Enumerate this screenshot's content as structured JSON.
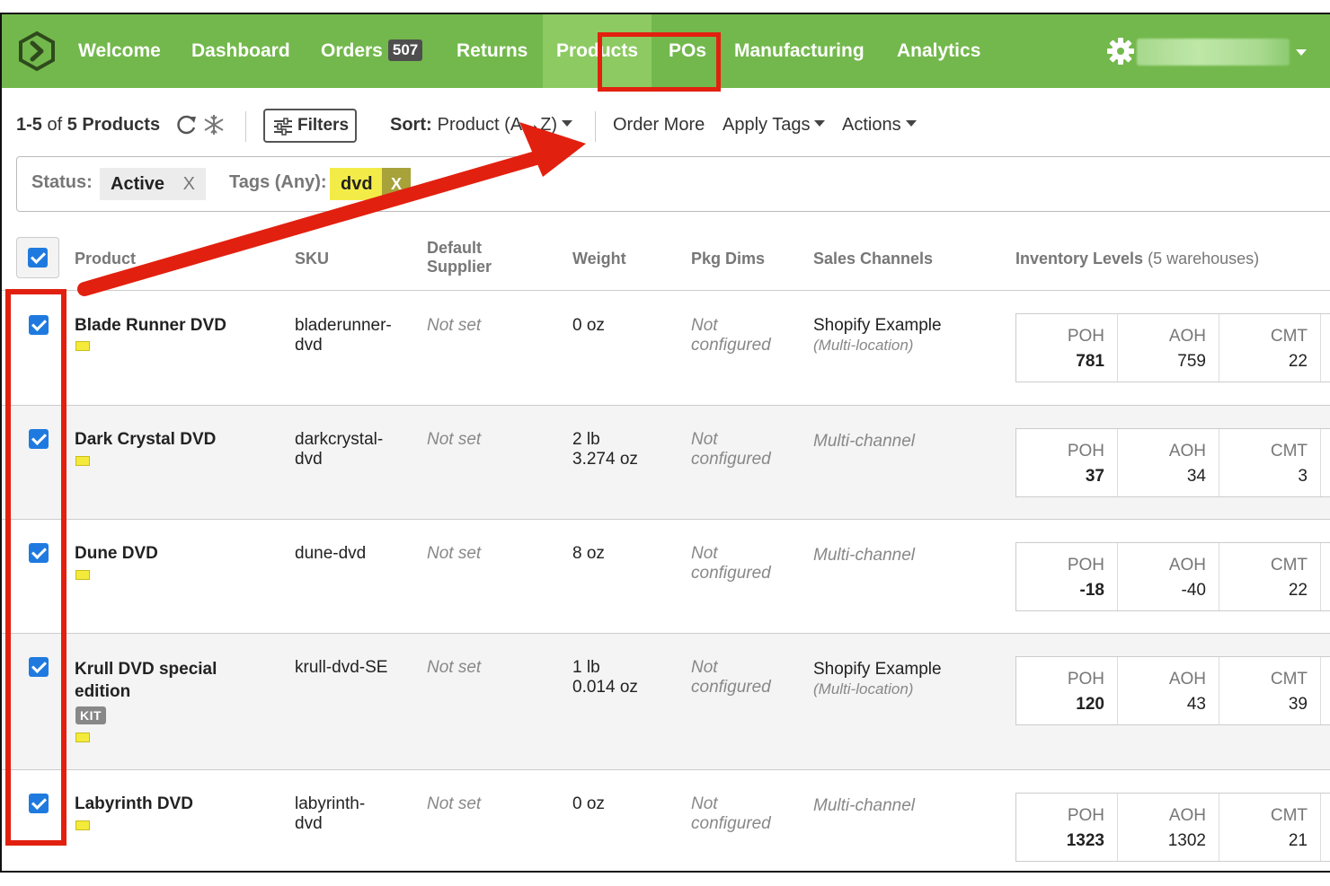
{
  "nav": {
    "items": [
      {
        "label": "Welcome"
      },
      {
        "label": "Dashboard"
      },
      {
        "label": "Orders",
        "badge": "507"
      },
      {
        "label": "Returns"
      },
      {
        "label": "Products",
        "active": true
      },
      {
        "label": "POs"
      },
      {
        "label": "Manufacturing"
      },
      {
        "label": "Analytics"
      }
    ],
    "logo_icon": "hexagon-chevron-logo",
    "settings_icon": "gear-icon",
    "accent": "#73b84c",
    "active_bg": "#8dca62"
  },
  "toolbar": {
    "range": "1-5",
    "of": "of",
    "count": "5 Products",
    "filters_label": "Filters",
    "sort_label": "Sort:",
    "sort_value": "Product (A→Z)",
    "order_more": "Order More",
    "apply_tags": "Apply Tags",
    "actions": "Actions"
  },
  "filterbar": {
    "status_label": "Status:",
    "status_value": "Active",
    "status_clear": "X",
    "tags_label": "Tags (Any):",
    "tag_value": "dvd",
    "tag_clear": "X",
    "tag_color": "#f3ec48"
  },
  "table": {
    "headers": {
      "product": "Product",
      "sku": "SKU",
      "supplier_1": "Default",
      "supplier_2": "Supplier",
      "weight": "Weight",
      "pkg": "Pkg Dims",
      "sales": "Sales Channels",
      "inventory": "Inventory Levels",
      "inventory_note": "(5 warehouses)"
    },
    "inv_headers": [
      "POH",
      "AOH",
      "CMT"
    ],
    "rows": [
      {
        "name": "Blade Runner DVD",
        "sku_1": "bladerunner-",
        "sku_2": "dvd",
        "supplier": "Not set",
        "weight_1": "0 oz",
        "weight_2": "",
        "pkg_1": "Not",
        "pkg_2": "configured",
        "channel_1": "Shopify Example",
        "channel_2": "(Multi-location)",
        "checked": true,
        "poh": "781",
        "aoh": "759",
        "cmt": "22"
      },
      {
        "name": "Dark Crystal DVD",
        "sku_1": "darkcrystal-",
        "sku_2": "dvd",
        "supplier": "Not set",
        "weight_1": "2 lb",
        "weight_2": "3.274 oz",
        "pkg_1": "Not",
        "pkg_2": "configured",
        "channel_1": "",
        "channel_2": "Multi-channel",
        "checked": true,
        "poh": "37",
        "aoh": "34",
        "cmt": "3"
      },
      {
        "name": "Dune DVD",
        "sku_1": "dune-dvd",
        "sku_2": "",
        "supplier": "Not set",
        "weight_1": "8 oz",
        "weight_2": "",
        "pkg_1": "Not",
        "pkg_2": "configured",
        "channel_1": "",
        "channel_2": "Multi-channel",
        "checked": true,
        "poh": "-18",
        "aoh": "-40",
        "cmt": "22"
      },
      {
        "name_1": "Krull DVD special",
        "name_2": "edition",
        "kit": "KIT",
        "sku_1": "krull-dvd-SE",
        "sku_2": "",
        "supplier": "Not set",
        "weight_1": "1 lb",
        "weight_2": "0.014 oz",
        "pkg_1": "Not",
        "pkg_2": "configured",
        "channel_1": "Shopify Example",
        "channel_2": "(Multi-location)",
        "checked": true,
        "poh": "120",
        "aoh": "43",
        "cmt": "39"
      },
      {
        "name": "Labyrinth DVD",
        "sku_1": "labyrinth-",
        "sku_2": "dvd",
        "supplier": "Not set",
        "weight_1": "0 oz",
        "weight_2": "",
        "pkg_1": "Not",
        "pkg_2": "configured",
        "channel_1": "",
        "channel_2": "Multi-channel",
        "checked": true,
        "poh": "1323",
        "aoh": "1302",
        "cmt": "21"
      }
    ]
  },
  "annotation": {
    "color": "#e2200f",
    "icon": "red-arrow-annotation"
  }
}
